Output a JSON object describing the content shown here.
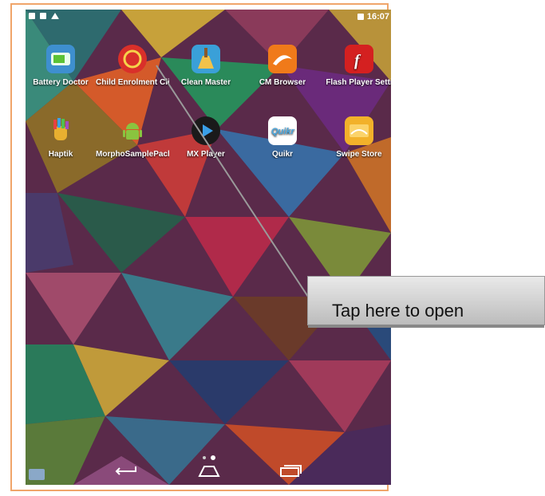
{
  "status_bar": {
    "time": "16:07",
    "left_icons": [
      "notification-icon",
      "image-icon",
      "warning-icon"
    ],
    "right_icons": [
      "battery-icon"
    ]
  },
  "home_screen": {
    "apps": [
      {
        "label": "Battery Doctor",
        "icon": "battery-doctor-icon",
        "color": "#3e8fcf"
      },
      {
        "label": "Child Enrolment Cli",
        "icon": "aadhaar-icon",
        "color": "#d9302a"
      },
      {
        "label": "Clean Master",
        "icon": "broom-icon",
        "color": "#3aa0d8"
      },
      {
        "label": "CM Browser",
        "icon": "cm-browser-icon",
        "color": "#f07a1a"
      },
      {
        "label": "Flash Player Setti",
        "icon": "flash-icon",
        "color": "#d42020"
      },
      {
        "label": "Haptik",
        "icon": "hand-icon",
        "color": "#e8b030"
      },
      {
        "label": "MorphoSamplePack",
        "icon": "android-icon",
        "color": "#8ac43f"
      },
      {
        "label": "MX Player",
        "icon": "play-icon",
        "color": "#1a1a1a"
      },
      {
        "label": "Quikr",
        "icon": "quikr-icon",
        "color": "#ffffff"
      },
      {
        "label": "Swipe Store",
        "icon": "swipe-store-icon",
        "color": "#f2b12a"
      }
    ],
    "page_indicator": {
      "pages": 2,
      "current": 2
    }
  },
  "nav_bar": {
    "buttons": [
      "back-icon",
      "home-icon",
      "recents-icon"
    ],
    "left_icon": "qr-scan-icon"
  },
  "callout": {
    "text": "Tap here to open"
  }
}
